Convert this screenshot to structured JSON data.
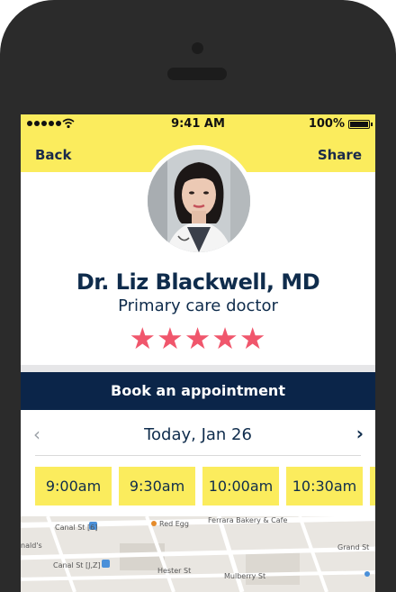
{
  "status_bar": {
    "time": "9:41 AM",
    "battery": "100%"
  },
  "nav": {
    "back_label": "Back",
    "share_label": "Share"
  },
  "doctor": {
    "name": "Dr. Liz Blackwell, MD",
    "specialty": "Primary care doctor",
    "rating_stars": "★★★★★",
    "rating": 5
  },
  "booking": {
    "title": "Book an appointment",
    "date": "Today, Jan 26",
    "prev_icon": "‹",
    "next_icon": "›",
    "slots": [
      "9:00am",
      "9:30am",
      "10:00am",
      "10:30am"
    ]
  },
  "map": {
    "labels": [
      "Canal St [6]",
      "Canal St [J,Z]",
      "Red Egg",
      "Ferrara Bakery & Cafe",
      "Hester St",
      "Mulberry St",
      "Grand St",
      "nald's"
    ]
  },
  "colors": {
    "accent_yellow": "#fbec5d",
    "navy": "#0b2549",
    "star_pink": "#f0566c"
  }
}
